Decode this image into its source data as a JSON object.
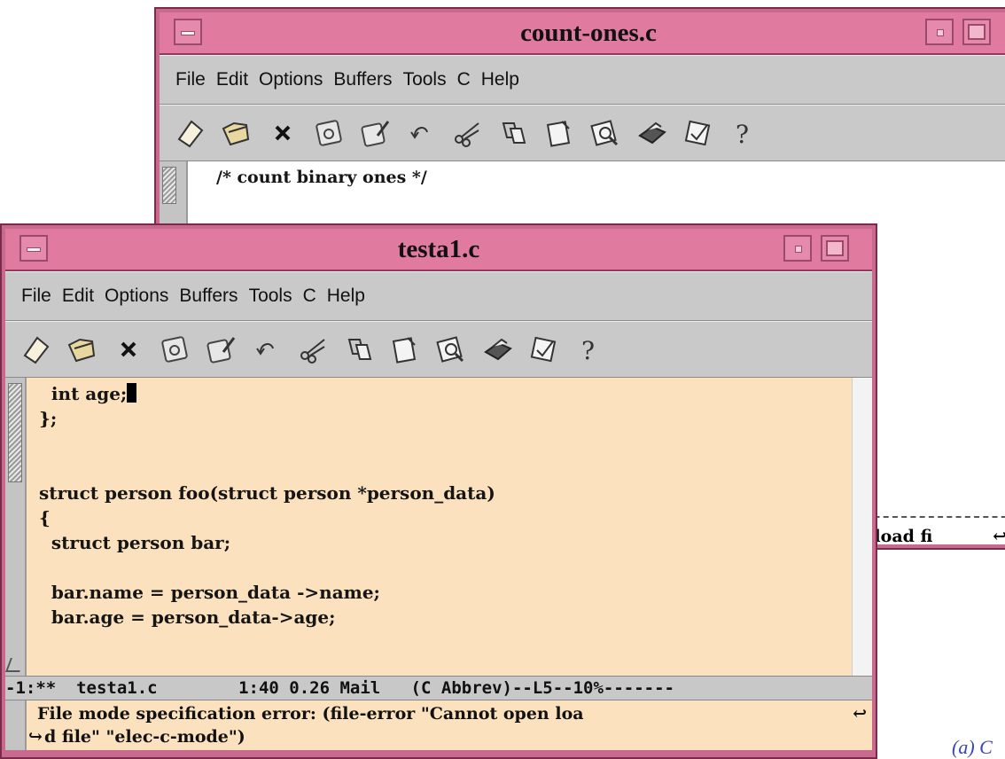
{
  "back_window": {
    "title": "count-ones.c",
    "menu": [
      "File",
      "Edit",
      "Options",
      "Buffers",
      "Tools",
      "C",
      "Help"
    ],
    "code_lines": [
      "/* count binary ones */"
    ],
    "minibuffer_fragment": "n load fi"
  },
  "front_window": {
    "title": "testa1.c",
    "menu": [
      "File",
      "Edit",
      "Options",
      "Buffers",
      "Tools",
      "C",
      "Help"
    ],
    "code": {
      "line1": "  int age;",
      "line2": "};",
      "line3": "",
      "line4": "",
      "line5": "struct person foo(struct person *person_data)",
      "line6": "{",
      "line7": "  struct person bar;",
      "line8": "",
      "line9": "  bar.name = person_data ->name;",
      "line10": "  bar.age = person_data->age;"
    },
    "modeline": "-1:**  testa1.c        1:40 0.26 Mail   (C Abbrev)--L5--10%-------",
    "minibuffer": {
      "line1": "File mode specification error: (file-error \"Cannot open loa",
      "line2": "d file\" \"elec-c-mode\")"
    }
  },
  "toolbar_icons": [
    "new-file-icon",
    "open-folder-icon",
    "close-icon",
    "save-disk-icon",
    "save-as-icon",
    "undo-icon",
    "cut-scissors-icon",
    "copy-icon",
    "paste-icon",
    "search-icon",
    "print-icon",
    "spellcheck-icon",
    "help-icon"
  ],
  "caption_fragment": "(a) C"
}
